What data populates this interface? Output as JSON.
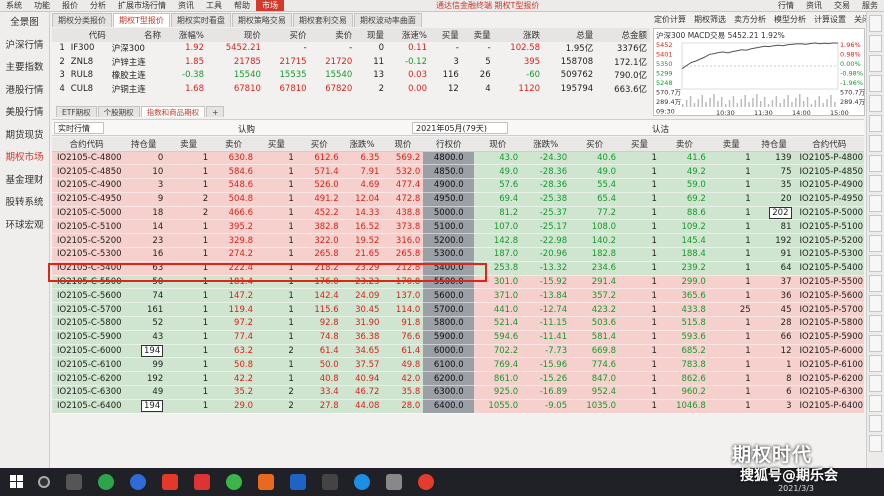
{
  "menubar": {
    "items": [
      "系统",
      "功能",
      "报价",
      "分析",
      "扩展市场行情",
      "资讯",
      "工具",
      "帮助",
      "市场"
    ],
    "center": "通达信金融终端 期权T型报价",
    "right": [
      "行情",
      "资讯",
      "交易",
      "服务"
    ]
  },
  "sidebar": [
    "全景图",
    "沪深行情",
    "主要指数",
    "港股行情",
    "美股行情",
    "期货现货",
    "期权市场",
    "基金理财",
    "股转系统",
    "环球宏观"
  ],
  "tabs_top": [
    "期权分类报价",
    "期权T型报价",
    "期权实时看盘",
    "期权策略交易",
    "期权套利交易",
    "期权波动率曲面"
  ],
  "tool_right": [
    "定价计算",
    "期权筛选",
    "卖方分析",
    "模型分析",
    "计算设置",
    "关闭"
  ],
  "quote_table": {
    "headers": [
      "",
      "代码",
      "名称",
      "涨幅%",
      "现价",
      "买价",
      "卖价",
      "现量",
      "涨速%",
      "买量",
      "卖量",
      "涨跌",
      "总量",
      "总金额"
    ],
    "rows": [
      [
        "1",
        "IF300",
        "沪深300",
        "1.92",
        "5452.21",
        "-",
        "-",
        "0",
        "0.11",
        "-",
        "-",
        "102.58",
        "1.95亿",
        "3376亿"
      ],
      [
        "2",
        "ZNL8",
        "沪锌主连",
        "1.85",
        "21785",
        "21715",
        "21720",
        "11",
        "-0.12",
        "3",
        "5",
        "395",
        "158708",
        "172.1亿"
      ],
      [
        "3",
        "RUL8",
        "橡胶主连",
        "-0.38",
        "15540",
        "15535",
        "15540",
        "13",
        "0.03",
        "116",
        "26",
        "-60",
        "509762",
        "790.0亿"
      ],
      [
        "4",
        "CUL8",
        "沪铜主连",
        "1.68",
        "67810",
        "67810",
        "67820",
        "2",
        "0.00",
        "12",
        "4",
        "1120",
        "195794",
        "663.6亿"
      ]
    ],
    "row_colors": [
      [
        "blk",
        "blk",
        "blk",
        "red",
        "red",
        "blk",
        "blk",
        "blk",
        "red",
        "blk",
        "blk",
        "red",
        "blk",
        "blk"
      ],
      [
        "blk",
        "blk",
        "blk",
        "red",
        "red",
        "red",
        "red",
        "blk",
        "green",
        "blk",
        "blk",
        "red",
        "blk",
        "blk"
      ],
      [
        "blk",
        "blk",
        "blk",
        "green",
        "green",
        "green",
        "green",
        "blk",
        "red",
        "blk",
        "blk",
        "green",
        "blk",
        "blk"
      ],
      [
        "blk",
        "blk",
        "blk",
        "red",
        "red",
        "red",
        "red",
        "blk",
        "red",
        "blk",
        "blk",
        "red",
        "blk",
        "blk"
      ]
    ]
  },
  "mini_chart": {
    "title": "沪深300  MACD交易  5452.21  1.92%",
    "left_ticks": [
      "5452",
      "5401",
      "5350",
      "5299",
      "5248",
      "570.7万",
      "289.4万",
      "09:30"
    ],
    "right_ticks": [
      "1.96%",
      "0.98%",
      "0.00%",
      "-0.98%",
      "-1.96%",
      "570.7万",
      "289.4万"
    ],
    "time_ticks": [
      "10:30",
      "11:30",
      "14:00",
      "15:00"
    ],
    "series": [
      5338,
      5352,
      5365,
      5372,
      5381,
      5390,
      5402,
      5405,
      5410,
      5412,
      5408,
      5414,
      5418,
      5422,
      5420,
      5426,
      5430,
      5434,
      5438,
      5436,
      5440,
      5442,
      5440,
      5444,
      5446,
      5448,
      5448,
      5446,
      5450,
      5452,
      5449,
      5451,
      5450,
      5452,
      5452
    ]
  },
  "tabs_mid": [
    "ETF期权",
    "个股期权",
    "指数和商品期权",
    "+"
  ],
  "filter": {
    "left": "实时行情",
    "call": "认购",
    "month": "2021年05月(79天)",
    "put": "认沽"
  },
  "options": {
    "headers": [
      "合约代码",
      "持仓量",
      "卖量",
      "卖价",
      "买量",
      "买价",
      "涨跌%",
      "现价",
      "行权价",
      "现价",
      "涨跌%",
      "买价",
      "买量",
      "卖价",
      "卖量",
      "持仓量",
      "合约代码"
    ],
    "rows": [
      [
        "IO2105-C-4800",
        "0",
        "1",
        "630.8",
        "1",
        "612.6",
        "6.35",
        "569.2",
        "4800.0",
        "43.0",
        "-24.30",
        "40.6",
        "1",
        "41.6",
        "1",
        "139",
        "IO2105-P-4800"
      ],
      [
        "IO2105-C-4850",
        "10",
        "1",
        "584.6",
        "1",
        "571.4",
        "7.91",
        "532.0",
        "4850.0",
        "49.0",
        "-28.36",
        "49.0",
        "1",
        "49.2",
        "1",
        "75",
        "IO2105-P-4850"
      ],
      [
        "IO2105-C-4900",
        "3",
        "1",
        "548.6",
        "1",
        "526.0",
        "4.69",
        "477.4",
        "4900.0",
        "57.6",
        "-28.36",
        "55.4",
        "1",
        "59.0",
        "1",
        "35",
        "IO2105-P-4900"
      ],
      [
        "IO2105-C-4950",
        "9",
        "2",
        "504.8",
        "1",
        "491.2",
        "12.04",
        "472.8",
        "4950.0",
        "69.4",
        "-25.38",
        "65.4",
        "1",
        "69.2",
        "1",
        "20",
        "IO2105-P-4950"
      ],
      [
        "IO2105-C-5000",
        "18",
        "2",
        "466.6",
        "1",
        "452.2",
        "14.33",
        "438.8",
        "5000.0",
        "81.2",
        "-25.37",
        "77.2",
        "1",
        "88.6",
        "1",
        "202",
        "IO2105-P-5000"
      ],
      [
        "IO2105-C-5100",
        "14",
        "1",
        "395.2",
        "1",
        "382.8",
        "16.52",
        "373.8",
        "5100.0",
        "107.0",
        "-25.17",
        "108.0",
        "1",
        "109.2",
        "1",
        "81",
        "IO2105-P-5100"
      ],
      [
        "IO2105-C-5200",
        "23",
        "1",
        "329.8",
        "1",
        "322.0",
        "19.52",
        "316.0",
        "5200.0",
        "142.8",
        "-22.98",
        "140.2",
        "1",
        "145.4",
        "1",
        "192",
        "IO2105-P-5200"
      ],
      [
        "IO2105-C-5300",
        "16",
        "1",
        "274.2",
        "1",
        "265.8",
        "21.65",
        "265.8",
        "5300.0",
        "187.0",
        "-20.96",
        "182.8",
        "1",
        "188.4",
        "1",
        "91",
        "IO2105-P-5300"
      ],
      [
        "IO2105-C-5400",
        "63",
        "1",
        "222.4",
        "1",
        "218.2",
        "23.29",
        "212.8",
        "5400.0",
        "253.8",
        "-13.32",
        "234.6",
        "1",
        "239.2",
        "1",
        "64",
        "IO2105-P-5400"
      ],
      [
        "IO2105-C-5500",
        "50",
        "1",
        "181.4",
        "1",
        "176.0",
        "23.23",
        "170.8",
        "5500.0",
        "301.0",
        "-15.92",
        "291.4",
        "1",
        "299.0",
        "1",
        "37",
        "IO2105-P-5500"
      ],
      [
        "IO2105-C-5600",
        "74",
        "1",
        "147.2",
        "1",
        "142.4",
        "24.09",
        "137.0",
        "5600.0",
        "371.0",
        "-13.84",
        "357.2",
        "1",
        "365.6",
        "1",
        "36",
        "IO2105-P-5600"
      ],
      [
        "IO2105-C-5700",
        "161",
        "1",
        "119.4",
        "1",
        "115.6",
        "30.45",
        "114.0",
        "5700.0",
        "441.0",
        "-12.74",
        "423.2",
        "1",
        "433.8",
        "25",
        "45",
        "IO2105-P-5700"
      ],
      [
        "IO2105-C-5800",
        "52",
        "1",
        "97.2",
        "1",
        "92.8",
        "31.90",
        "91.8",
        "5800.0",
        "521.4",
        "-11.15",
        "503.6",
        "1",
        "515.8",
        "1",
        "28",
        "IO2105-P-5800"
      ],
      [
        "IO2105-C-5900",
        "43",
        "1",
        "77.4",
        "1",
        "74.8",
        "36.38",
        "76.6",
        "5900.0",
        "594.6",
        "-11.41",
        "581.4",
        "1",
        "593.6",
        "1",
        "66",
        "IO2105-P-5900"
      ],
      [
        "IO2105-C-6000",
        "194",
        "1",
        "63.2",
        "2",
        "61.4",
        "34.65",
        "61.4",
        "6000.0",
        "702.2",
        "-7.73",
        "669.8",
        "1",
        "685.2",
        "1",
        "12",
        "IO2105-P-6000"
      ],
      [
        "IO2105-C-6100",
        "99",
        "1",
        "50.8",
        "1",
        "50.0",
        "37.57",
        "49.8",
        "6100.0",
        "769.4",
        "-15.96",
        "774.6",
        "1",
        "783.8",
        "1",
        "1",
        "IO2105-P-6100"
      ],
      [
        "IO2105-C-6200",
        "192",
        "1",
        "42.2",
        "1",
        "40.8",
        "40.94",
        "42.0",
        "6200.0",
        "861.0",
        "-15.26",
        "847.0",
        "1",
        "862.6",
        "1",
        "8",
        "IO2105-P-6200"
      ],
      [
        "IO2105-C-6300",
        "49",
        "1",
        "35.2",
        "2",
        "33.4",
        "46.72",
        "35.8",
        "6300.0",
        "925.0",
        "-16.89",
        "952.4",
        "1",
        "960.2",
        "1",
        "6",
        "IO2105-P-6300"
      ],
      [
        "IO2105-C-6400",
        "194",
        "1",
        "29.0",
        "2",
        "27.8",
        "44.08",
        "28.0",
        "6400.0",
        "1055.0",
        "-9.05",
        "1035.0",
        "1",
        "1046.8",
        "1",
        "3",
        "IO2105-P-6400"
      ]
    ],
    "boxed": [
      [
        4,
        15
      ],
      [
        14,
        1
      ],
      [
        18,
        1
      ]
    ],
    "itm_call_rows": 9
  },
  "taskbar": {
    "clock_time": "11:27",
    "clock_date": "2021/3/3"
  },
  "watermark": {
    "line1": "期权时代",
    "line2": "搜狐号@期乐会"
  },
  "colors": {
    "accent": "#d23a2b",
    "up": "#d4251a",
    "down": "#159a2c",
    "itm": "#f6d0cc",
    "otm": "#cfe5cf",
    "highlight": "#e02416"
  }
}
